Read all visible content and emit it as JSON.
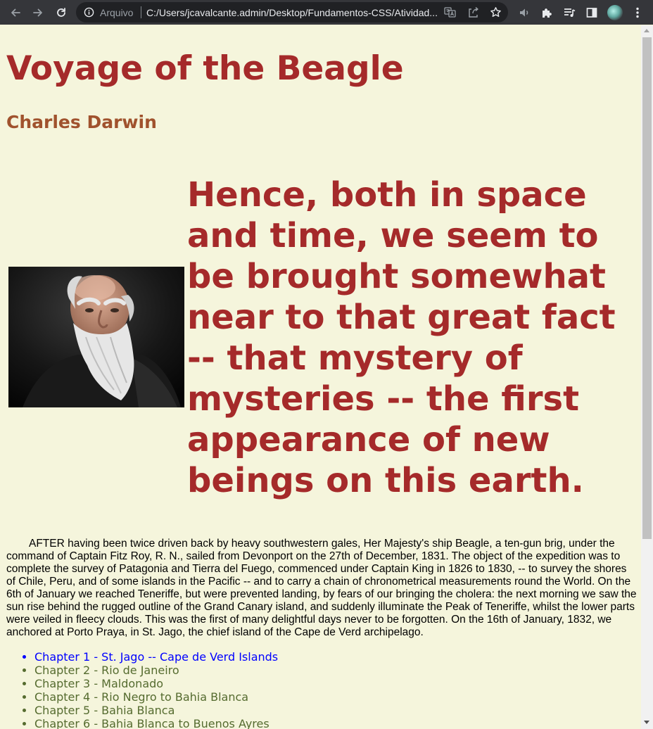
{
  "browser": {
    "scheme_label": "Arquivo",
    "url": "C:/Users/jcavalcante.admin/Desktop/Fundamentos-CSS/Atividad..."
  },
  "page": {
    "title": "Voyage of the Beagle",
    "author": "Charles Darwin",
    "quote": "Hence, both in space and time, we seem to be brought somewhat near to that great fact -- that mystery of mysteries -- the first appearance of new beings on this earth.",
    "intro": "AFTER having been twice driven back by heavy southwestern gales, Her Majesty's ship Beagle, a ten-gun brig, under the command of Captain Fitz Roy, R. N., sailed from Devonport on the 27th of December, 1831. The object of the expedition was to complete the survey of Patagonia and Tierra del Fuego, commenced under Captain King in 1826 to 1830, -- to survey the shores of Chile, Peru, and of some islands in the Pacific -- and to carry a chain of chronometrical measurements round the World. On the 6th of January we reached Teneriffe, but were prevented landing, by fears of our bringing the cholera: the next morning we saw the sun rise behind the rugged outline of the Grand Canary island, and suddenly illuminate the Peak of Teneriffe, whilst the lower parts were veiled in fleecy clouds. This was the first of many delightful days never to be forgotten. On the 16th of January, 1832, we anchored at Porto Praya, in St. Jago, the chief island of the Cape de Verd archipelago.",
    "chapters": [
      {
        "label": "Chapter 1 - St. Jago -- Cape de Verd Islands"
      },
      {
        "label": "Chapter 2 - Rio de Janeiro"
      },
      {
        "label": "Chapter 3 - Maldonado"
      },
      {
        "label": "Chapter 4 - Rio Negro to Bahia Blanca"
      },
      {
        "label": "Chapter 5 - Bahia Blanca"
      },
      {
        "label": "Chapter 6 - Bahia Blanca to Buenos Ayres"
      }
    ]
  },
  "colors": {
    "background": "#f5f5dc",
    "heading": "#a52a2a",
    "author": "#a0522d",
    "link_active": "#0000ff",
    "link": "#556b2f"
  }
}
